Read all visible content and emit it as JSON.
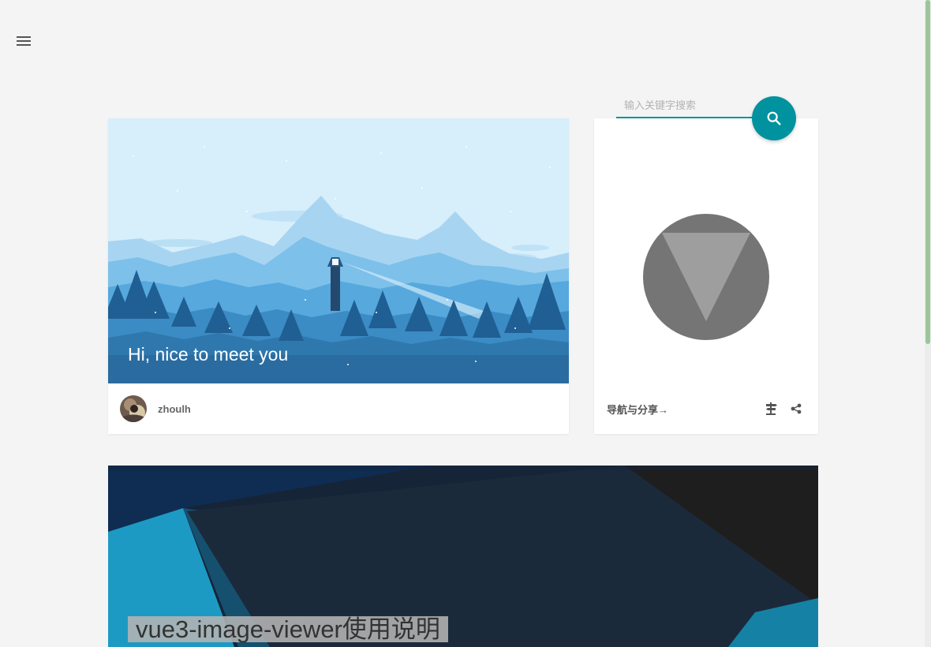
{
  "header": {
    "menu_icon": "hamburger-menu-icon"
  },
  "search": {
    "placeholder": "输入关键字搜索",
    "value": "",
    "button_icon": "search-icon",
    "accent_color": "#00929e"
  },
  "hero": {
    "title": "Hi, nice to meet you",
    "author": "zhoulh",
    "avatar_icon": "avatar-image",
    "background": "mountain-lighthouse-illustration"
  },
  "side": {
    "logo": "material-logo",
    "nav_label": "导航与分享→",
    "icons": [
      "signpost-icon",
      "share-icon"
    ]
  },
  "post": {
    "title": "vue3-image-viewer使用说明",
    "background": "material-geometric-background"
  },
  "colors": {
    "page_bg": "#f4f4f4",
    "card_bg": "#ffffff",
    "accent": "#00929e",
    "scrollbar_thumb": "#9ac79a"
  }
}
